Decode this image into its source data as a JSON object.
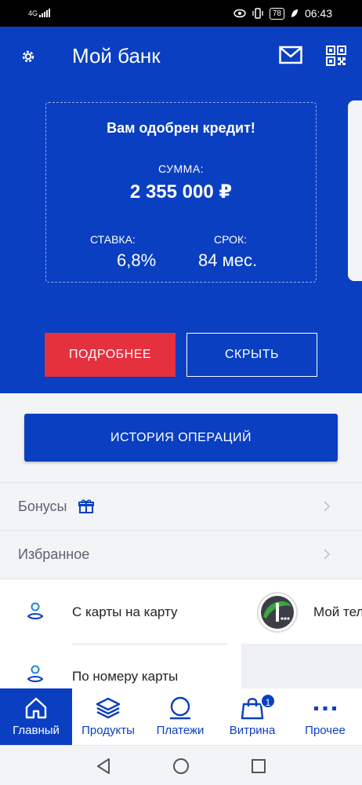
{
  "status_bar": {
    "network": "4G",
    "battery": "78",
    "time": "06:43"
  },
  "header": {
    "title": "Мой банк",
    "icons": [
      "gear-icon",
      "mail-icon",
      "qr-code-icon"
    ]
  },
  "offer": {
    "heading": "Вам одобрен кредит!",
    "sum_label": "СУММА:",
    "sum_value": "2 355 000 ₽",
    "rate_label": "СТАВКА:",
    "rate_value": "6,8%",
    "term_label": "СРОК:",
    "term_value": "84 мес.",
    "more_button": "ПОДРОБНЕЕ",
    "hide_button": "СКРЫТЬ"
  },
  "history_button": "ИСТОРИЯ ОПЕРАЦИЙ",
  "rows": {
    "bonuses": "Бонусы",
    "favorites": "Избранное"
  },
  "transfers": {
    "card_to_card": "С карты на карту",
    "by_card_number": "По номеру карты",
    "operator": "Мой тел"
  },
  "bottom_nav": {
    "items": [
      {
        "label": "Главный",
        "icon": "home-icon"
      },
      {
        "label": "Продукты",
        "icon": "layers-icon"
      },
      {
        "label": "Платежи",
        "icon": "payments-icon"
      },
      {
        "label": "Витрина",
        "icon": "shopping-bag-icon",
        "badge": "1"
      },
      {
        "label": "Прочее",
        "icon": "more-icon"
      }
    ]
  },
  "colors": {
    "brand_blue": "#0a3fc2",
    "accent_red": "#e5303d"
  }
}
